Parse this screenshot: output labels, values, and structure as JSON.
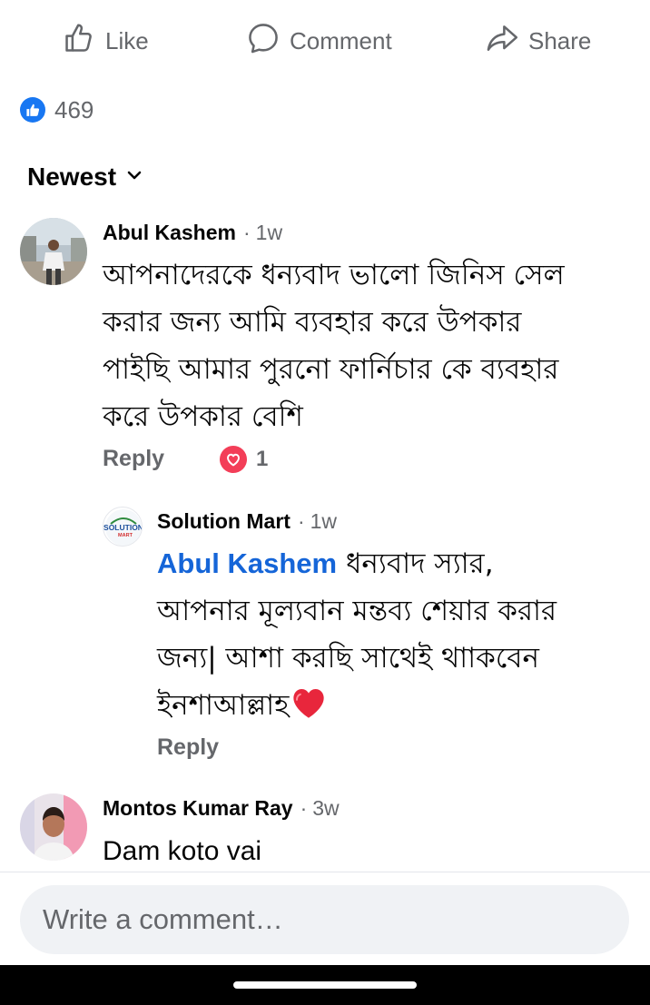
{
  "actions": {
    "like_label": "Like",
    "comment_label": "Comment",
    "share_label": "Share"
  },
  "reactions": {
    "icon": "thumbs-up-icon",
    "count": "469",
    "badge_color": "#1877f2"
  },
  "sort": {
    "label": "Newest",
    "icon": "chevron-down-icon"
  },
  "comments": [
    {
      "author": "Abul Kashem",
      "time": "1w",
      "text_lines": [
        "আপনাদেরকে ধন্যবাদ ভালো জিনিস সেল",
        "করার জন্য আমি ব্যবহার করে উপকার",
        "পাইছি আমার পুরনো ফার্নিচার কে ব্যবহার",
        "করে উপকার বেশি"
      ],
      "reply_label": "Reply",
      "reaction_icon": "heart-icon",
      "reaction_count": "1",
      "reply": {
        "author": "Solution Mart",
        "avatar_text_line1": "SOLUTION",
        "avatar_text_line2": "MART",
        "time": "1w",
        "mention": "Abul Kashem",
        "text_lines": [
          " ধন্যবাদ স্যার,",
          "আপনার মূল্যবান মন্তব্য শেয়ার করার",
          "জন্য| আশা করছি সাথেই থাাকবেন",
          "ইনশাআল্লাহ"
        ],
        "emoji_icon": "red-heart-icon",
        "reply_label": "Reply"
      }
    },
    {
      "author": "Montos Kumar Ray",
      "time": "3w",
      "text": "Dam koto vai"
    }
  ],
  "composer": {
    "placeholder": "Write a comment…"
  },
  "colors": {
    "secondary_text": "#65676b",
    "mention": "#1565d8",
    "love": "#f33e58",
    "input_bg": "#f0f2f5"
  }
}
